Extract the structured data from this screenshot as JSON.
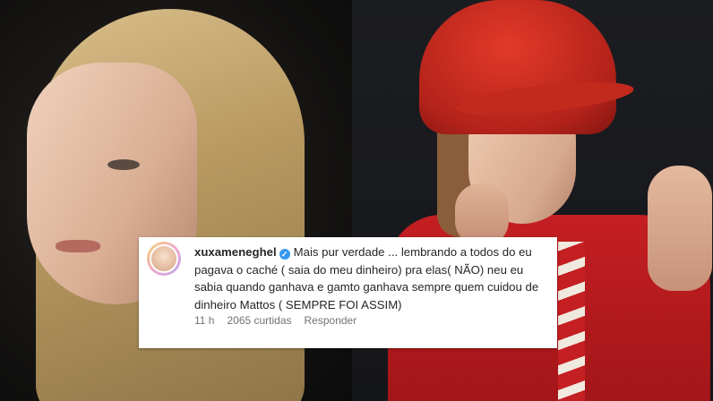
{
  "comment": {
    "username": "xuxameneghel",
    "verified_icon": "verified-badge-icon",
    "text": "Mais pur verdade ... lembrando a todos do eu pagava o caché ( saia do meu dinheiro) pra elas( NÃO) neu eu sabia quando ganhava e gamto ganhava sempre quem cuidou de dinheiro Mattos ( SEMPRE FOI ASSIM)",
    "time": "11 h",
    "likes": "2065 curtidas",
    "reply_label": "Responder"
  },
  "colors": {
    "verified_blue": "#3897f0",
    "text_primary": "#262626",
    "text_secondary": "#737373",
    "card_bg": "#ffffff"
  }
}
